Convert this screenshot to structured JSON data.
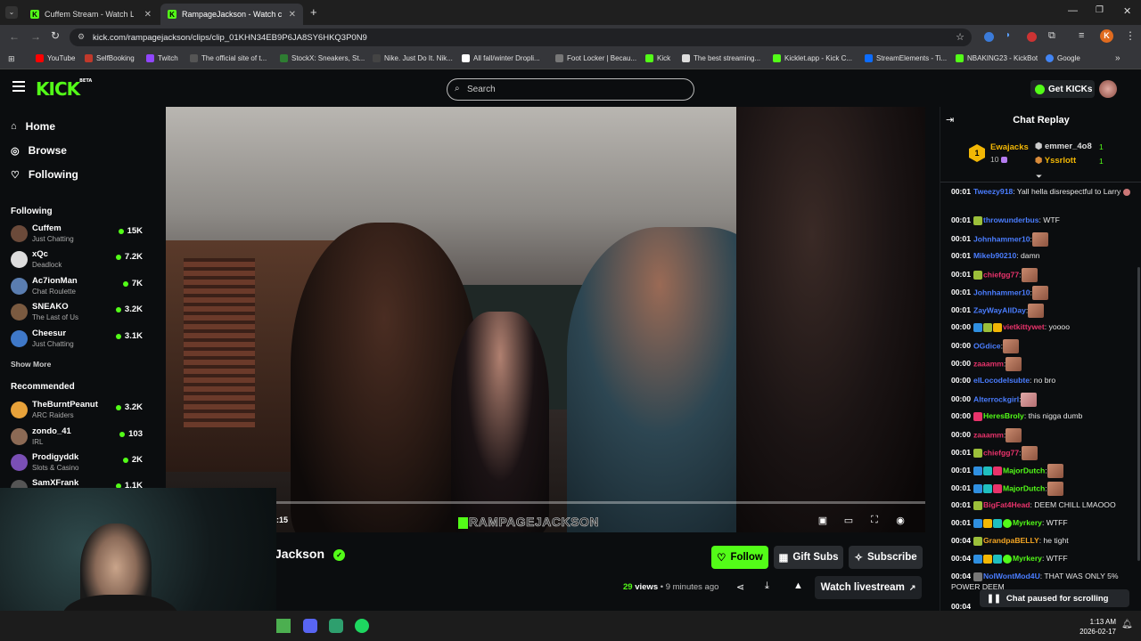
{
  "browser": {
    "tabs": [
      {
        "title": "Cuffem Stream - Watch Live",
        "active": false
      },
      {
        "title": "RampageJackson - Watch clips",
        "active": true
      }
    ],
    "url": "kick.com/rampagejackson/clips/clip_01KHN34EB9P6JA8SY6HKQ3P0N9",
    "profile_letter": "K",
    "bookmarks": [
      "YouTube",
      "SelfBooking",
      "Twitch",
      "The official site of t...",
      "StockX: Sneakers, St...",
      "Nike. Just Do It. Nik...",
      "All fall/winter Dropli...",
      "Foot Locker | Becau...",
      "Kick",
      "The best streaming...",
      "Kicklet.app - Kick C...",
      "StreamElements - Ti...",
      "NBAKING23 - KickBot",
      "Google"
    ]
  },
  "kick": {
    "logo": "KICK",
    "logo_tag": "BETA",
    "search_placeholder": "Search",
    "get_kicks": "Get KICKs",
    "accent": "#53fc18"
  },
  "sidebar": {
    "nav": [
      {
        "label": "Home",
        "icon": "home-icon"
      },
      {
        "label": "Browse",
        "icon": "compass-icon"
      },
      {
        "label": "Following",
        "icon": "heart-icon"
      }
    ],
    "following_heading": "Following",
    "following": [
      {
        "name": "Cuffem",
        "category": "Just Chatting",
        "viewers": "15K"
      },
      {
        "name": "xQc",
        "category": "Deadlock",
        "viewers": "7.2K"
      },
      {
        "name": "Ac7ionMan",
        "category": "Chat Roulette",
        "viewers": "7K"
      },
      {
        "name": "SNEAKO",
        "category": "The Last of Us",
        "viewers": "3.2K"
      },
      {
        "name": "Cheesur",
        "category": "Just Chatting",
        "viewers": "3.1K"
      }
    ],
    "show_more": "Show More",
    "recommended_heading": "Recommended",
    "recommended": [
      {
        "name": "TheBurntPeanut",
        "category": "ARC Raiders",
        "viewers": "3.2K"
      },
      {
        "name": "zondo_41",
        "category": "IRL",
        "viewers": "103"
      },
      {
        "name": "Prodigyddk",
        "category": "Slots & Casino",
        "viewers": "2K"
      },
      {
        "name": "SamXFrank",
        "category": "",
        "viewers": "1.1K"
      }
    ]
  },
  "video": {
    "time": ":15",
    "watermark": "RAMPAGEJACKSON"
  },
  "clip_info": {
    "channel_name": "Jackson",
    "follow_label": "Follow",
    "gift_subs_label": "Gift Subs",
    "subscribe_label": "Subscribe",
    "views_count": "29",
    "views_word": "views",
    "age": "9 minutes ago",
    "watch_livestream_label": "Watch livestream"
  },
  "chat": {
    "title": "Chat Replay",
    "leaderboard": {
      "first_name": "Ewajacks",
      "first_rank": "1",
      "first_count": "10",
      "second_name": "emmer_4o8",
      "second_count": "1",
      "third_name": "Yssrlott",
      "third_count": "1"
    },
    "messages": [
      {
        "time": "00:01",
        "user": "Tweezy918",
        "color": "#4a7dff",
        "text": ": Yall hella disrespectful to Larry",
        "emote": false
      },
      {
        "time": "00:01",
        "user": "throwunderbus",
        "color": "#4a7dff",
        "text": ": WTF",
        "emote": false
      },
      {
        "time": "00:01",
        "user": "Johnhammer10",
        "color": "#4a7dff",
        "text": ":",
        "emote": true
      },
      {
        "time": "00:01",
        "user": "Mikeb90210",
        "color": "#4a7dff",
        "text": ": damn",
        "emote": false
      },
      {
        "time": "00:01",
        "user": "chiefgg77",
        "color": "#e8336b",
        "text": ":",
        "emote": true
      },
      {
        "time": "00:01",
        "user": "Johnhammer10",
        "color": "#4a7dff",
        "text": ":",
        "emote": true
      },
      {
        "time": "00:01",
        "user": "ZayWayAllDay",
        "color": "#4a7dff",
        "text": ":",
        "emote": true
      },
      {
        "time": "00:00",
        "user": "vietkittywet",
        "color": "#e8336b",
        "text": ": yoooo",
        "emote": false
      },
      {
        "time": "00:00",
        "user": "OGdice",
        "color": "#4a7dff",
        "text": ":",
        "emote": true
      },
      {
        "time": "00:00",
        "user": "zaaamm",
        "color": "#e8336b",
        "text": ":",
        "emote": true
      },
      {
        "time": "00:00",
        "user": "elLocodelsubte",
        "color": "#4a7dff",
        "text": ": no bro",
        "emote": false
      },
      {
        "time": "00:00",
        "user": "Alterrockgirl",
        "color": "#4a7dff",
        "text": ":",
        "emote": true
      },
      {
        "time": "00:00",
        "user": "HeresBroly",
        "color": "#53fc18",
        "text": ": this nigga dumb",
        "emote": false
      },
      {
        "time": "00:00",
        "user": "zaaamm",
        "color": "#e8336b",
        "text": ":",
        "emote": true
      },
      {
        "time": "00:01",
        "user": "chiefgg77",
        "color": "#e8336b",
        "text": ":",
        "emote": true
      },
      {
        "time": "00:01",
        "user": "MajorDutch",
        "color": "#53fc18",
        "text": ":",
        "emote": true
      },
      {
        "time": "00:01",
        "user": "MajorDutch",
        "color": "#53fc18",
        "text": ":",
        "emote": true
      },
      {
        "time": "00:01",
        "user": "BigFat4Head",
        "color": "#e8336b",
        "text": ": DEEM CHILL LMAOOO",
        "emote": false
      },
      {
        "time": "00:01",
        "user": "Myrkery",
        "color": "#53fc18",
        "text": ": WTFF",
        "emote": false
      },
      {
        "time": "00:04",
        "user": "GrandpaBELLY",
        "color": "#f5a623",
        "text": ": he tight",
        "emote": false
      },
      {
        "time": "00:04",
        "user": "Myrkery",
        "color": "#53fc18",
        "text": ": WTFF",
        "emote": false
      },
      {
        "time": "00:04",
        "user": "NoIWontMod4U",
        "color": "#4a7dff",
        "text": ": THAT WAS ONLY 5% POWER DEEM",
        "emote": false
      }
    ],
    "last_time": "00:04",
    "paused_label": "Chat paused for scrolling"
  },
  "taskbar": {
    "time": "1:13 AM",
    "date": "2026-02-17"
  }
}
